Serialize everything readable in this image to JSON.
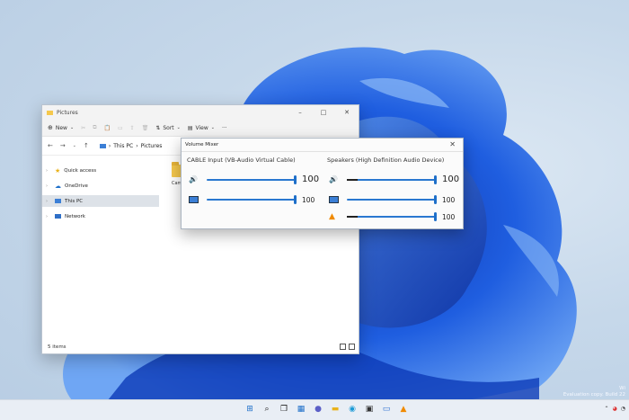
{
  "colors": {
    "accent": "#1e6fc9",
    "folder": "#f5c84c",
    "wallpaper_blue": "#1f5ee0"
  },
  "explorer": {
    "title": "Pictures",
    "toolbar": {
      "new_label": "New",
      "sort_label": "Sort",
      "view_label": "View"
    },
    "breadcrumb": [
      "This PC",
      "Pictures"
    ],
    "sidebar": [
      {
        "label": "Quick access",
        "icon": "star-icon"
      },
      {
        "label": "OneDrive",
        "icon": "cloud-icon"
      },
      {
        "label": "This PC",
        "icon": "pc-icon",
        "selected": true
      },
      {
        "label": "Network",
        "icon": "network-icon"
      }
    ],
    "folder_label": "Camera Ro",
    "status": "5 items"
  },
  "mixer": {
    "title": "Volume Mixer",
    "devices": [
      {
        "name": "CABLE Input (VB-Audio Virtual Cable)",
        "channels": [
          {
            "icon": "speaker-icon",
            "value": "100",
            "level": 1.0
          },
          {
            "icon": "system-sounds-icon",
            "value": "100",
            "level": 1.0
          }
        ]
      },
      {
        "name": "Speakers (High Definition Audio Device)",
        "channels": [
          {
            "icon": "speaker-icon",
            "value": "100",
            "level": 1.0
          },
          {
            "icon": "system-sounds-icon",
            "value": "100",
            "level": 1.0
          },
          {
            "icon": "vlc-icon",
            "value": "100",
            "level": 1.0
          }
        ]
      }
    ]
  },
  "watermark": {
    "line1": "Wi",
    "line2": "Evaluation copy. Build 22"
  }
}
